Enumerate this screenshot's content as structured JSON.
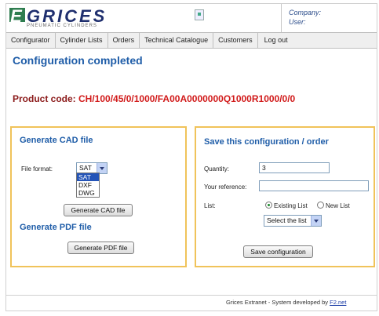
{
  "header": {
    "logo_text": "GRICES",
    "logo_letter": "E",
    "logo_tagline": "PNEUMATIC CYLINDERS",
    "company_label": "Company:",
    "user_label": "User:"
  },
  "nav": {
    "items": [
      {
        "label": "Configurator"
      },
      {
        "label": "Cylinder Lists"
      },
      {
        "label": "Orders"
      },
      {
        "label": "Technical Catalogue"
      },
      {
        "label": "Customers"
      },
      {
        "label": "Log out"
      }
    ]
  },
  "main": {
    "title": "Configuration completed",
    "product_code_label": "Product code:",
    "product_code_value": "CH/100/45/0/1000/FA00A0000000Q1000R1000/0/0"
  },
  "cad": {
    "title": "Generate CAD file",
    "file_format_label": "File format:",
    "selected_format": "SAT",
    "formats": [
      "SAT",
      "DXF",
      "DWG"
    ],
    "generate_cad_button": "Generate CAD file",
    "pdf_title": "Generate PDF file",
    "generate_pdf_button": "Generate PDF file"
  },
  "save": {
    "title": "Save this configuration / order",
    "quantity_label": "Quantity:",
    "quantity_value": "3",
    "reference_label": "Your reference:",
    "reference_value": "",
    "list_label": "List:",
    "existing_list_label": "Existing List",
    "new_list_label": "New List",
    "list_select_value": "Select the list",
    "save_button": "Save configuration"
  },
  "footer": {
    "text": "Grices Extranet - System developed by ",
    "link": "F2.net"
  },
  "colors": {
    "accent": "#1f5da8",
    "panel_border": "#f0c35a",
    "product_code": "#d11a1a"
  }
}
